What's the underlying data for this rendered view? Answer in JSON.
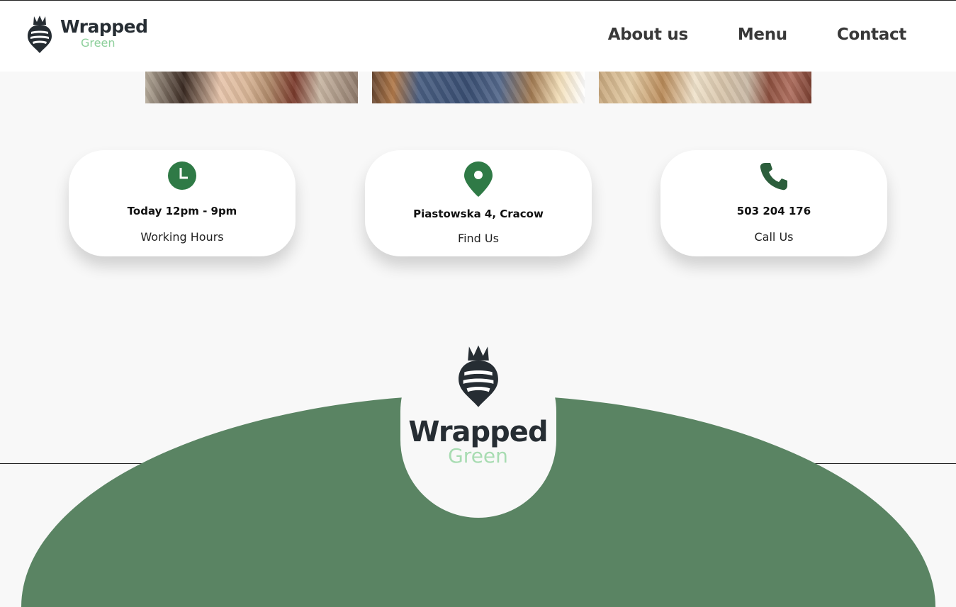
{
  "brand": {
    "name": "Wrapped",
    "tagline": "Green",
    "accent": "#2f7a46",
    "dark": "#262d33",
    "footer_green": "#5a8463"
  },
  "nav": {
    "items": [
      "About us",
      "Menu",
      "Contact"
    ]
  },
  "cards": [
    {
      "icon": "clock-icon",
      "title": "Today 12pm - 9pm",
      "subtitle": "Working Hours"
    },
    {
      "icon": "location-pin-icon",
      "title": "Piastowska 4, Cracow",
      "subtitle": "Find Us"
    },
    {
      "icon": "phone-icon",
      "title": "503 204 176",
      "subtitle": "Call Us"
    }
  ],
  "footer": {
    "brand": "Wrapped",
    "tagline": "Green"
  }
}
